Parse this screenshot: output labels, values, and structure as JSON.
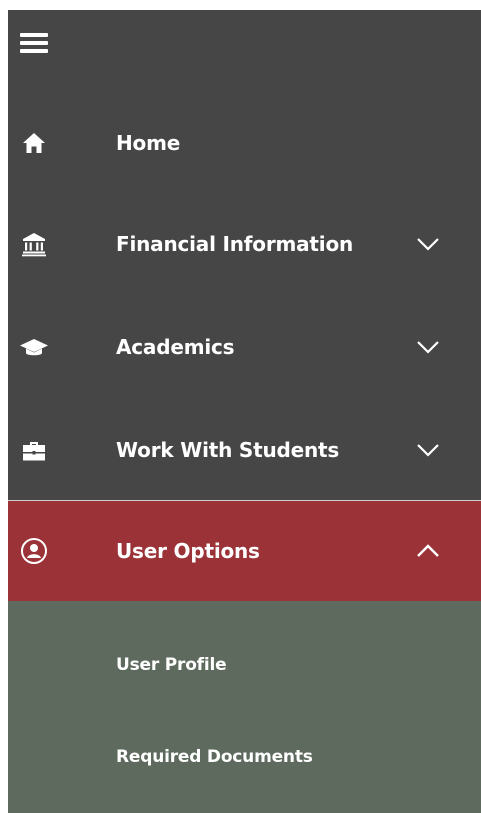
{
  "nav": {
    "menu_icon": "hamburger-icon",
    "items": [
      {
        "label": "Home",
        "icon": "home-icon"
      },
      {
        "label": "Financial Information",
        "icon": "bank-icon",
        "chevron": "chevron-down-icon"
      },
      {
        "label": "Academics",
        "icon": "graduation-cap-icon",
        "chevron": "chevron-down-icon"
      },
      {
        "label": "Work With Students",
        "icon": "briefcase-icon",
        "chevron": "chevron-down-icon"
      },
      {
        "label": "User Options",
        "icon": "user-circle-icon",
        "chevron": "chevron-up-icon",
        "expanded": true
      }
    ],
    "submenu": [
      {
        "label": "User Profile"
      },
      {
        "label": "Required Documents"
      }
    ]
  },
  "colors": {
    "nav_background": "#464646",
    "active_background": "#9a3237",
    "submenu_background": "#5e6a5e",
    "text": "#ffffff"
  }
}
